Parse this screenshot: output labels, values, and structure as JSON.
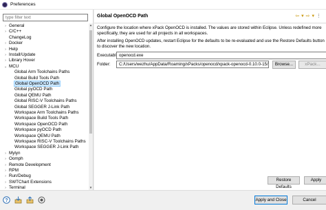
{
  "window": {
    "title": "Preferences"
  },
  "filter": {
    "placeholder": "type filter text"
  },
  "tree": [
    {
      "label": "General",
      "arrow": "›",
      "indent": 0
    },
    {
      "label": "C/C++",
      "arrow": "›",
      "indent": 0
    },
    {
      "label": "ChangeLog",
      "arrow": "",
      "indent": 0
    },
    {
      "label": "Docker",
      "arrow": "›",
      "indent": 0
    },
    {
      "label": "Help",
      "arrow": "›",
      "indent": 0
    },
    {
      "label": "Install/Update",
      "arrow": "›",
      "indent": 0
    },
    {
      "label": "Library Hover",
      "arrow": "›",
      "indent": 0
    },
    {
      "label": "MCU",
      "arrow": "⌄",
      "indent": 0
    },
    {
      "label": "Global Arm Toolchains Paths",
      "arrow": "",
      "indent": 1
    },
    {
      "label": "Global Build Tools Path",
      "arrow": "",
      "indent": 1
    },
    {
      "label": "Global OpenOCD Path",
      "arrow": "",
      "indent": 1,
      "selected": true
    },
    {
      "label": "Global pyOCD Path",
      "arrow": "",
      "indent": 1
    },
    {
      "label": "Global QEMU Path",
      "arrow": "",
      "indent": 1
    },
    {
      "label": "Global RISC-V Toolchains Paths",
      "arrow": "",
      "indent": 1
    },
    {
      "label": "Global SEGGER J-Link Path",
      "arrow": "",
      "indent": 1
    },
    {
      "label": "Workspace Arm Toolchains Paths",
      "arrow": "",
      "indent": 1
    },
    {
      "label": "Workspace Build Tools Path",
      "arrow": "",
      "indent": 1
    },
    {
      "label": "Workspace OpenOCD Path",
      "arrow": "",
      "indent": 1
    },
    {
      "label": "Workspace pyOCD Path",
      "arrow": "",
      "indent": 1
    },
    {
      "label": "Workspace QEMU Path",
      "arrow": "",
      "indent": 1
    },
    {
      "label": "Workspace RISC-V Toolchains Paths",
      "arrow": "",
      "indent": 1
    },
    {
      "label": "Workspace SEGGER J-Link Path",
      "arrow": "",
      "indent": 1
    },
    {
      "label": "Mylyn",
      "arrow": "›",
      "indent": 0
    },
    {
      "label": "Oomph",
      "arrow": "›",
      "indent": 0
    },
    {
      "label": "Remote Development",
      "arrow": "›",
      "indent": 0
    },
    {
      "label": "RPM",
      "arrow": "›",
      "indent": 0
    },
    {
      "label": "Run/Debug",
      "arrow": "›",
      "indent": 0
    },
    {
      "label": "SWTChart Extensions",
      "arrow": "›",
      "indent": 0
    },
    {
      "label": "Terminal",
      "arrow": "›",
      "indent": 0
    }
  ],
  "page": {
    "title": "Global OpenOCD Path",
    "description1": "Configure the location where xPack OpenOCD is installed. The values are stored within Eclipse. Unless redefined more specifically, they are used for all projects in all workspaces.",
    "description2": "After installing OpenOCD updates, restart Eclipse for the defaults to be re-evaluated and use the Restore Defaults button to discover the new location.",
    "executable_label": "Executable:",
    "executable_value": "openocd.exe",
    "folder_label": "Folder:",
    "folder_value": "C:/Users/wezhu/AppData/Roaming/xPacks/openocd/xpack-openocd-0.10.0-15/bin",
    "browse_label": "Browse...",
    "xpack_label": "xPack..."
  },
  "buttons": {
    "restore_defaults": "Restore Defaults",
    "apply": "Apply",
    "apply_and_close": "Apply and Close",
    "cancel": "Cancel"
  },
  "icons": [
    "help-icon",
    "import-icon",
    "export-icon",
    "link-icon"
  ]
}
